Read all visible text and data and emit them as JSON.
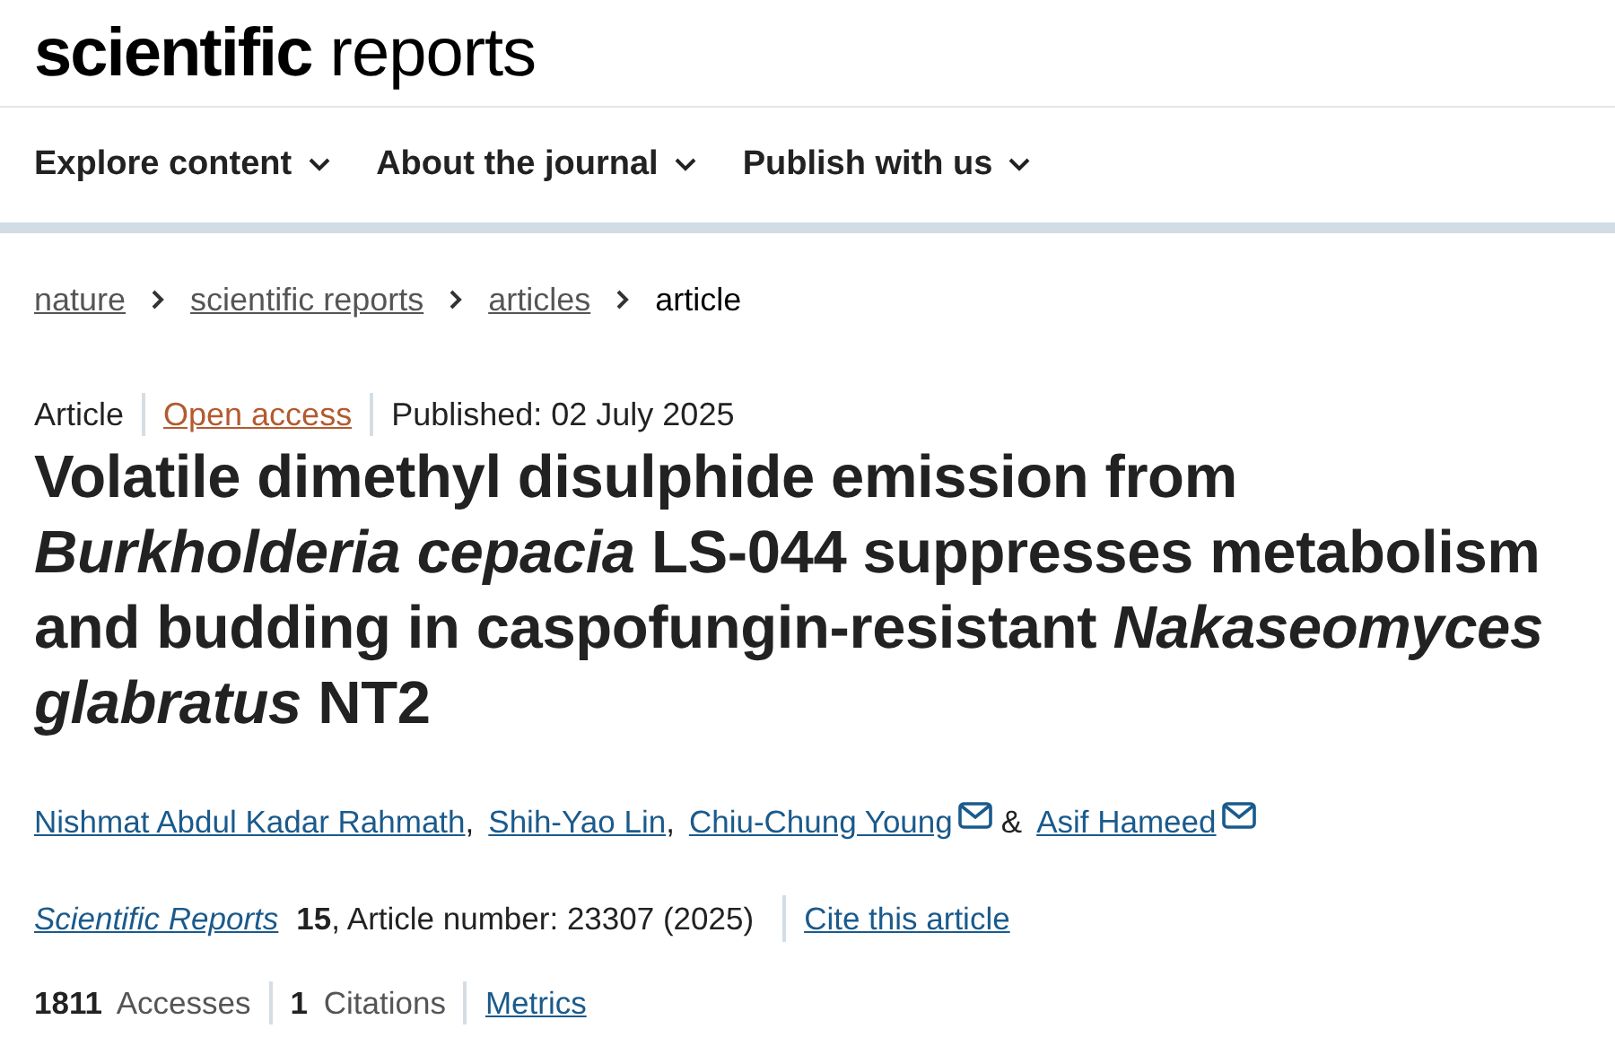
{
  "logo": {
    "text": "**scientific** reports"
  },
  "nav": [
    {
      "label": "Explore content"
    },
    {
      "label": "About the journal"
    },
    {
      "label": "Publish with us"
    }
  ],
  "breadcrumbs": [
    {
      "label": "nature",
      "current": false
    },
    {
      "label": "scientific reports",
      "current": false
    },
    {
      "label": "articles",
      "current": false
    },
    {
      "label": "article",
      "current": true
    }
  ],
  "meta": {
    "type": "Article",
    "access": "Open access",
    "published": "Published: 02 July 2025"
  },
  "title": "Volatile dimethyl disulphide emission from *Burkholderia cepacia* LS-044 suppresses metabolism and budding in caspofungin-resistant *Nakaseomyces glabratus* NT2",
  "authors": [
    {
      "name": "Nishmat Abdul Kadar Rahmath",
      "email": false,
      "separator": ","
    },
    {
      "name": "Shih-Yao Lin",
      "email": false,
      "separator": ","
    },
    {
      "name": "Chiu-Chung Young",
      "email": true,
      "separator": "&"
    },
    {
      "name": "Asif Hameed",
      "email": true
    }
  ],
  "citation": {
    "journal": "Scientific Reports",
    "details": "**15**, Article number: 23307 (2025)",
    "cite_link": "Cite this article"
  },
  "metrics": [
    {
      "text": "**1811** Accesses"
    },
    {
      "text": "**1** Citations"
    }
  ],
  "metrics_link": "Metrics"
}
